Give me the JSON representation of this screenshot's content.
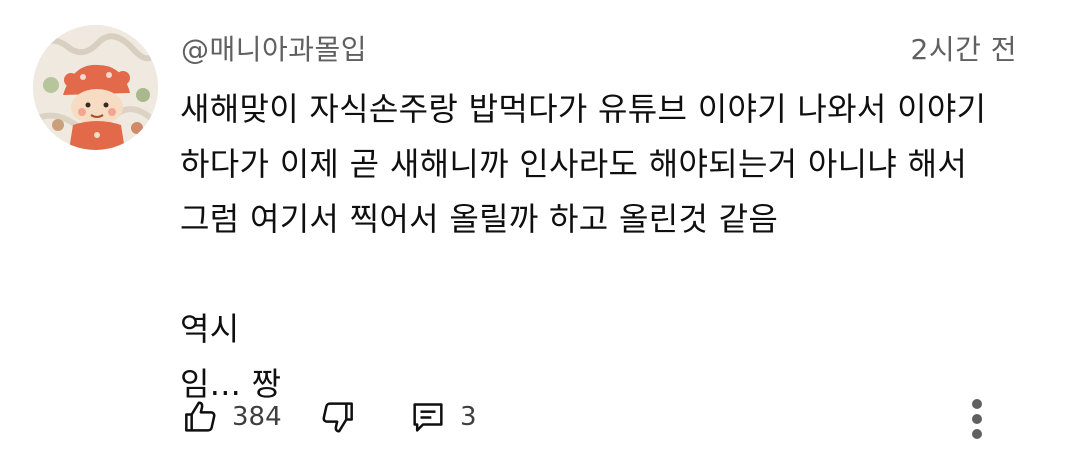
{
  "comment": {
    "author": "@매니아과몰입",
    "time": "2시간 전",
    "lines": [
      "새해맞이 자식손주랑 밥먹다가 유튜브 이야기 나와서 이야기",
      "하다가 이제 곧 새해니까 인사라도 해야되는거 아니냐 해서",
      "그럼 여기서 찍어서 올릴까 하고 올린것 같음",
      "",
      "역시",
      "임... 짱"
    ],
    "like_count": "384",
    "reply_count": "3"
  },
  "icons": {
    "like": "thumbs-up-icon",
    "dislike": "thumbs-down-icon",
    "reply": "comment-icon",
    "more": "vertical-ellipsis-icon"
  }
}
